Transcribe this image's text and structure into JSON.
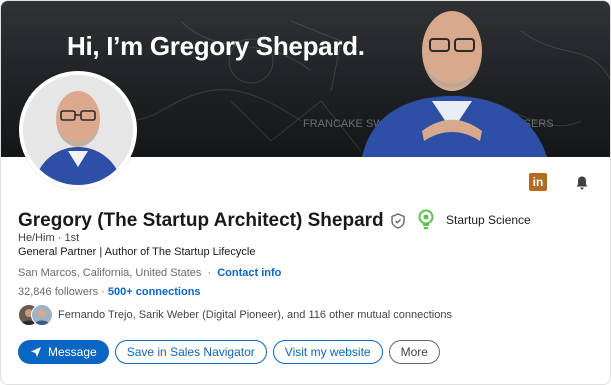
{
  "banner": {
    "title": "Hi, I’m Gregory Shepard."
  },
  "profile": {
    "name": "Gregory (The Startup Architect) Shepard",
    "pronouns": "He/Him",
    "degree": "1st",
    "headline": "General Partner | Author of The Startup Lifecycle",
    "location": "San Marcos, California, United States",
    "contact_info": "Contact info",
    "followers": "32,846 followers",
    "connections": "500+ connections",
    "mutual_connections": "Fernando Trejo, Sarik Weber (Digital Pioneer), and 116 other mutual connections"
  },
  "company": {
    "name": "Startup Science",
    "logo_icon": "lightbulb-icon",
    "logo_color": "#5fbf4a"
  },
  "top_icons": {
    "linkedin": "linkedin-icon",
    "bell": "bell-icon"
  },
  "actions": {
    "message": "Message",
    "save_sales_navigator": "Save in Sales Navigator",
    "visit_website": "Visit my website",
    "more": "More"
  },
  "colors": {
    "accent": "#0a66c2",
    "linkedin_badge": "#b76a1c"
  }
}
